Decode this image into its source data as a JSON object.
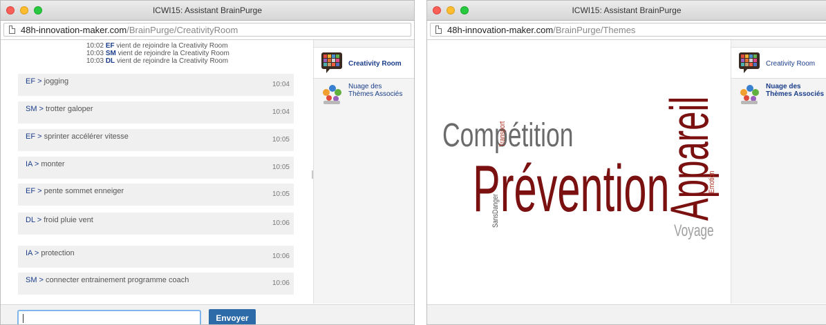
{
  "window1": {
    "title": "ICWI15: Assistant BrainPurge",
    "url_host": "48h-innovation-maker.com",
    "url_path": "/BrainPurge/CreativityRoom",
    "join_text": "vient de rejoindre la Creativity Room",
    "joins": [
      {
        "time": "10:02",
        "initials": "EF"
      },
      {
        "time": "10:03",
        "initials": "SM"
      },
      {
        "time": "10:03",
        "initials": "DL"
      }
    ],
    "messages": [
      {
        "who": "EF",
        "text": "jogging",
        "time": "10:04"
      },
      {
        "who": "SM",
        "text": "trotter galoper",
        "time": "10:04"
      },
      {
        "who": "EF",
        "text": "sprinter accélérer vitesse",
        "time": "10:05"
      },
      {
        "who": "IA",
        "text": "monter",
        "time": "10:05"
      },
      {
        "who": "EF",
        "text": "pente sommet enneiger",
        "time": "10:05"
      },
      {
        "who": "DL",
        "text": "froid pluie vent",
        "time": "10:06"
      },
      {
        "who": "IA",
        "text": "protection",
        "time": "10:06"
      },
      {
        "who": "SM",
        "text": "connecter entrainement programme coach",
        "time": "10:06"
      }
    ],
    "sidebar": {
      "creativity_room": "Creativity Room",
      "nuage_line1": "Nuage des",
      "nuage_line2": "Thèmes Associés"
    },
    "input_value": "",
    "send_label": "Envoyer"
  },
  "window2": {
    "title": "ICWI15: Assistant BrainPurge",
    "url_host": "48h-innovation-maker.com",
    "url_path": "/BrainPurge/Themes",
    "sidebar": {
      "creativity_room": "Creativity Room",
      "nuage_line1": "Nuage des",
      "nuage_line2": "Thèmes Associés"
    },
    "cloud_words": {
      "competition": "Compétition",
      "prevention": "Prévention",
      "appareil": "Appareil",
      "transport": "Transport",
      "emotion": "Emotion",
      "sansdanger": "SansDanger",
      "voyage": "Voyage"
    }
  },
  "colors": {
    "name_blue": "#1a3d8a",
    "button_blue": "#2d6ba8",
    "cloud_dark_red": "#7a1010",
    "cloud_red": "#b03020",
    "cloud_gray": "#6b6b6b",
    "cloud_light_gray": "#a0a0a0"
  }
}
